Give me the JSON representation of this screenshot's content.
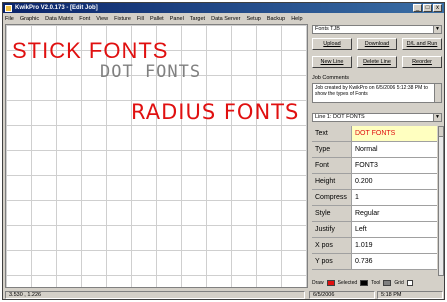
{
  "window": {
    "title": "KwikPro V2.0.173 - [Edit Job]",
    "controls": {
      "minimize": "_",
      "maximize": "□",
      "close": "x"
    }
  },
  "menu": [
    "File",
    "Graphic",
    "Data Matrix",
    "Font",
    "View",
    "Fixture",
    "Fill",
    "Pallet",
    "Panel",
    "Target",
    "Data Server",
    "Setup",
    "Backup",
    "Help"
  ],
  "canvas": {
    "stick_text": "STICK FONTS",
    "dot_text": "DOT FONTS",
    "radius_text": "RADIUS FONTS"
  },
  "panel": {
    "file_select": "Fonts TJB",
    "buttons": {
      "upload": "Upload",
      "download": "Download",
      "dl_run": "D/L and Run",
      "new_line": "New Line",
      "delete_line": "Delete Line",
      "reorder": "Reorder"
    },
    "job_comments_label": "Job Comments",
    "job_comments": "Job created by KwikPro on 6/5/2006 5:12:38 PM to show the types of Fonts",
    "line_select": "Line 1: DOT FONTS",
    "properties": [
      {
        "name": "Text",
        "value": "DOT FONTS"
      },
      {
        "name": "Type",
        "value": "Normal"
      },
      {
        "name": "Font",
        "value": "FONT3"
      },
      {
        "name": "Height",
        "value": "0.200"
      },
      {
        "name": "Compress",
        "value": "1"
      },
      {
        "name": "Style",
        "value": "Regular"
      },
      {
        "name": "Justify",
        "value": "Left"
      },
      {
        "name": "X pos",
        "value": "1.019"
      },
      {
        "name": "Y pos",
        "value": "0.736"
      }
    ],
    "legend": {
      "draw": "Draw",
      "selected": "Selected",
      "tool": "Tool",
      "grid": "Grid"
    },
    "colors": {
      "draw": "#e01010",
      "selected": "#000000",
      "tool": "#808080"
    }
  },
  "status": {
    "coords": "3.530 , 1.226",
    "date": "6/5/2006",
    "time": "5:18 PM"
  }
}
